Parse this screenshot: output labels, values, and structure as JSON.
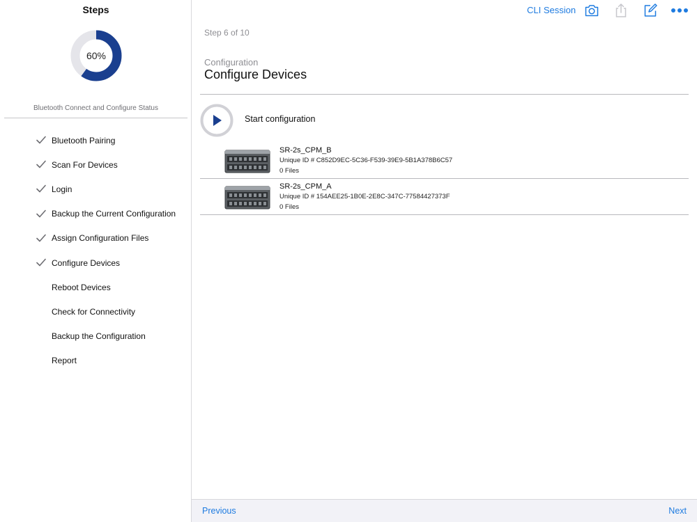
{
  "sidebar": {
    "title": "Steps",
    "progress": {
      "percent_label": "60%",
      "fraction": 0.6
    },
    "status_caption": "Bluetooth Connect and Configure Status",
    "steps": [
      {
        "label": "Bluetooth Pairing",
        "done": true
      },
      {
        "label": "Scan For Devices",
        "done": true
      },
      {
        "label": "Login",
        "done": true
      },
      {
        "label": "Backup the Current Configuration",
        "done": true
      },
      {
        "label": "Assign Configuration Files",
        "done": true
      },
      {
        "label": "Configure Devices",
        "done": true
      },
      {
        "label": "Reboot Devices",
        "done": false
      },
      {
        "label": "Check for Connectivity",
        "done": false
      },
      {
        "label": "Backup the Configuration",
        "done": false
      },
      {
        "label": "Report",
        "done": false
      }
    ]
  },
  "toolbar": {
    "cli_session": "CLI Session",
    "icons": [
      "camera-icon",
      "share-icon",
      "compose-icon",
      "more-icon"
    ]
  },
  "main": {
    "step_counter": "Step 6 of 10",
    "section": "Configuration",
    "title": "Configure Devices",
    "start_label": "Start configuration",
    "devices": [
      {
        "name": "SR-2s_CPM_B",
        "uid": "Unique ID # C852D9EC-5C36-F539-39E9-5B1A378B6C57",
        "files": "0 Files"
      },
      {
        "name": "SR-2s_CPM_A",
        "uid": "Unique ID # 154AEE25-1B0E-2E8C-347C-77584427373F",
        "files": "0 Files"
      }
    ]
  },
  "footer": {
    "previous": "Previous",
    "next": "Next"
  },
  "colors": {
    "accent": "#1e7be0",
    "progress_ring": "#1a3f8f",
    "progress_track": "#e5e5ea",
    "check": "#6e6e73",
    "play": "#1a3f8f"
  }
}
